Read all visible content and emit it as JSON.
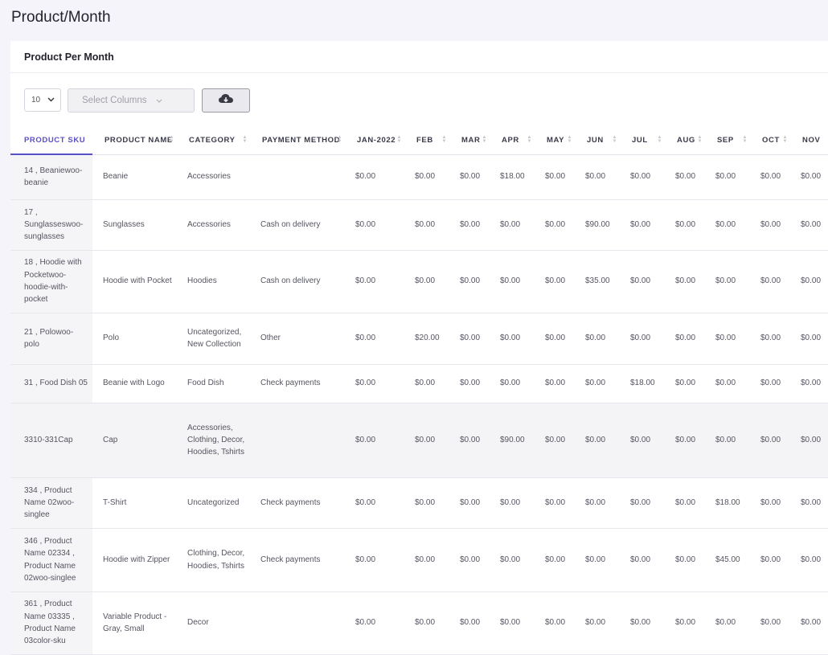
{
  "page": {
    "title": "Product/Month"
  },
  "card": {
    "title": "Product Per Month"
  },
  "toolbar": {
    "page_size": "10",
    "select_columns_placeholder": "Select Columns"
  },
  "icons": {
    "download": "cloud-download-icon",
    "dropdown": "chevron-down-icon",
    "sort": "sort-icon"
  },
  "colors": {
    "accent": "#5a4fc8",
    "background": "#f5f4fa"
  },
  "table": {
    "headers": [
      "PRODUCT SKU",
      "PRODUCT NAME",
      "CATEGORY",
      "PAYMENT METHOD",
      "JAN-2022",
      "FEB",
      "MAR",
      "APR",
      "MAY",
      "JUN",
      "JUL",
      "AUG",
      "SEP",
      "OCT",
      "NOV"
    ],
    "rows": [
      [
        "14 , Beaniewoo-beanie",
        "Beanie",
        "Accessories",
        "",
        "$0.00",
        "$0.00",
        "$0.00",
        "$18.00",
        "$0.00",
        "$0.00",
        "$0.00",
        "$0.00",
        "$0.00",
        "$0.00",
        "$0.00"
      ],
      [
        "17 , Sunglasseswoo-sunglasses",
        "Sunglasses",
        "Accessories",
        "Cash on delivery",
        "$0.00",
        "$0.00",
        "$0.00",
        "$0.00",
        "$0.00",
        "$90.00",
        "$0.00",
        "$0.00",
        "$0.00",
        "$0.00",
        "$0.00"
      ],
      [
        "18 , Hoodie with Pocketwoo-hoodie-with-pocket",
        "Hoodie with Pocket",
        "Hoodies",
        "Cash on delivery",
        "$0.00",
        "$0.00",
        "$0.00",
        "$0.00",
        "$0.00",
        "$35.00",
        "$0.00",
        "$0.00",
        "$0.00",
        "$0.00",
        "$0.00"
      ],
      [
        "21 , Polowoo-polo",
        "Polo",
        "Uncategorized, New Collection",
        "Other",
        "$0.00",
        "$20.00",
        "$0.00",
        "$0.00",
        "$0.00",
        "$0.00",
        "$0.00",
        "$0.00",
        "$0.00",
        "$0.00",
        "$0.00"
      ],
      [
        "31 , Food Dish 05",
        "Beanie with Logo",
        "Food Dish",
        "Check payments",
        "$0.00",
        "$0.00",
        "$0.00",
        "$0.00",
        "$0.00",
        "$0.00",
        "$18.00",
        "$0.00",
        "$0.00",
        "$0.00",
        "$0.00"
      ],
      [
        "3310-331Cap",
        "Cap",
        "Accessories, Clothing, Decor, Hoodies, Tshirts",
        "",
        "$0.00",
        "$0.00",
        "$0.00",
        "$90.00",
        "$0.00",
        "$0.00",
        "$0.00",
        "$0.00",
        "$0.00",
        "$0.00",
        "$0.00"
      ],
      [
        "334 , Product Name 02woo-singlee",
        "T-Shirt",
        "Uncategorized",
        "Check payments",
        "$0.00",
        "$0.00",
        "$0.00",
        "$0.00",
        "$0.00",
        "$0.00",
        "$0.00",
        "$0.00",
        "$18.00",
        "$0.00",
        "$0.00"
      ],
      [
        "346 , Product Name 02334 , Product Name 02woo-singlee",
        "Hoodie with Zipper",
        "Clothing, Decor, Hoodies, Tshirts",
        "Check payments",
        "$0.00",
        "$0.00",
        "$0.00",
        "$0.00",
        "$0.00",
        "$0.00",
        "$0.00",
        "$0.00",
        "$45.00",
        "$0.00",
        "$0.00"
      ],
      [
        "361 , Product Name 03335 , Product Name 03color-sku",
        "Variable Product - Gray, Small",
        "Decor",
        "",
        "$0.00",
        "$0.00",
        "$0.00",
        "$0.00",
        "$0.00",
        "$0.00",
        "$0.00",
        "$0.00",
        "$0.00",
        "$0.00",
        "$0.00"
      ]
    ]
  }
}
